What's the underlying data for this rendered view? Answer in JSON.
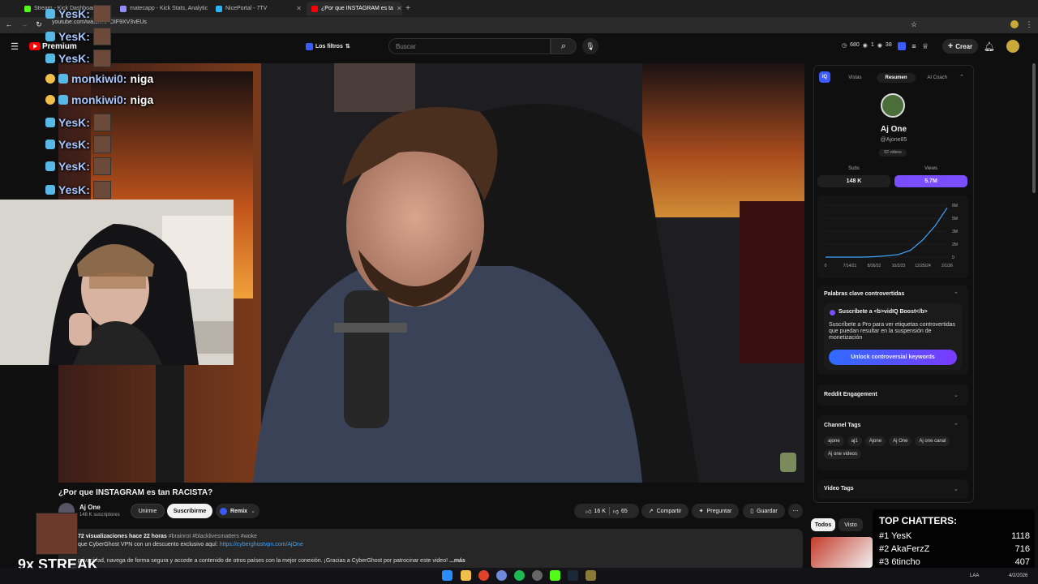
{
  "browser": {
    "tabs": [
      {
        "label": "Stream - Kick Dashboard",
        "color": "#53fc18"
      },
      {
        "label": "matecapp - Kick Stats, Analytic",
        "color": "#8e8eff"
      },
      {
        "label": "NicePortal - 7TV",
        "color": "#29b6f6"
      },
      {
        "label": "¿Por que INSTAGRAM es ta",
        "color": "#ff0000"
      }
    ],
    "url": "youtube.com/watch?v=DIF9XV3vEUs"
  },
  "youtube": {
    "logo": "Premium",
    "filters_label": "Los filtros",
    "search_placeholder": "Buscar",
    "stats": {
      "a": "680",
      "b": "1",
      "c": "38"
    },
    "create_label": "Crear"
  },
  "video": {
    "title": "¿Por que INSTAGRAM es tan RACISTA?",
    "channel": "Aj One",
    "subscribers": "148 K suscriptores",
    "join_label": "Unirme",
    "subscribe_label": "Suscribirme",
    "remix_label": "Remix",
    "likes": "16 K",
    "dislikes": "65",
    "share_label": "Compartir",
    "ask_label": "Preguntar",
    "save_label": "Guardar",
    "description": {
      "views": "72 visualizaciones",
      "time": "hace 22 horas",
      "tags": "#brainrot #blacklivesmatters #woke",
      "line2_prefix": "que CyberGhost VPN con un descuento exclusivo aquí:",
      "line2_link": "https://cyberghostvpn.com/AjOne",
      "line3": "privacidad, navega de forma segura y accede a contenido de otros países con la mejor conexión. ¡Gracias a CyberGhost por patrocinar este video!",
      "more": "...más"
    }
  },
  "vidiq": {
    "tabs": [
      "Vistas",
      "Resumen",
      "AI Coach"
    ],
    "channel_name": "Aj One",
    "handle": "@Ajone85",
    "videos": "92 videos",
    "subs_label": "Subs",
    "subs_value": "148 K",
    "views_label": "Views",
    "views_value": "5.7M",
    "chart_data": {
      "type": "line",
      "x": [
        "0",
        "7/14/21",
        "8/26/22",
        "10/2/23",
        "12/25/24",
        "2/1/26"
      ],
      "y_ticks": [
        "0",
        "2M",
        "3M",
        "5M",
        "6M"
      ],
      "values": [
        0,
        0,
        0,
        0,
        0.05,
        0.15,
        0.3,
        0.8,
        2.0,
        3.6,
        5.7
      ],
      "ylim": [
        0,
        6
      ]
    },
    "keywords_title": "Palabras clave controvertidas",
    "promo_title": "Suscríbete a <b>vidIQ Boost</b>",
    "promo_text": "Suscríbete a Pro para ver etiquetas controvertidas que puedan resultar en la suspensión de monetización",
    "unlock_label": "Unlock controversial keywords",
    "reddit_title": "Reddit Engagement",
    "tags_title": "Channel Tags",
    "tags": [
      "ajone",
      "aj1",
      "Ajone",
      "Aj One",
      "Aj one canal",
      "Aj one videos"
    ],
    "video_tags_title": "Video Tags"
  },
  "chips": [
    "Todos",
    "Visto"
  ],
  "overlay": {
    "chat": [
      {
        "user": "YesK:",
        "msg": ""
      },
      {
        "user": "YesK:",
        "msg": ""
      },
      {
        "user": "YesK:",
        "msg": ""
      },
      {
        "user": "monkiwi0:",
        "msg": "niga"
      },
      {
        "user": "monkiwi0:",
        "msg": "niga"
      },
      {
        "user": "YesK:",
        "msg": ""
      },
      {
        "user": "YesK:",
        "msg": ""
      },
      {
        "user": "YesK:",
        "msg": ""
      },
      {
        "user": "YesK:",
        "msg": ""
      }
    ],
    "top_chatters_title": "TOP CHATTERS:",
    "top_chatters": [
      {
        "rank": "#1",
        "name": "YesK",
        "count": "1118"
      },
      {
        "rank": "#2",
        "name": "AkaFerzZ",
        "count": "716"
      },
      {
        "rank": "#3",
        "name": "6tincho",
        "count": "407"
      }
    ],
    "streak": "9x STREAK"
  },
  "taskbar": {
    "lang": "LAA",
    "date": "4/2/2026"
  }
}
